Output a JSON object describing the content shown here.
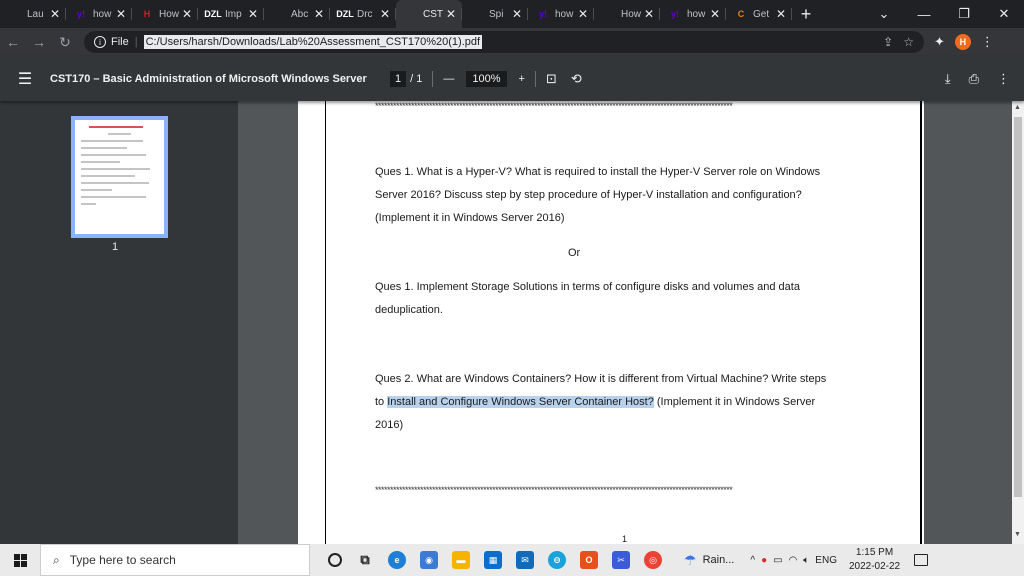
{
  "browser": {
    "tabs": [
      {
        "title": "Lau",
        "icon": "chrome-icon",
        "fav_text": "",
        "color": "#e8eaed",
        "active": false
      },
      {
        "title": "how",
        "icon": "yahoo-icon",
        "fav_text": "y!",
        "color": "#6001d2",
        "active": false
      },
      {
        "title": "How",
        "icon": "h-logo-icon",
        "fav_text": "H",
        "color": "#d11f2a",
        "active": false
      },
      {
        "title": "Imp",
        "icon": "dzl-icon",
        "fav_text": "DZL",
        "color": "#ffffff",
        "active": false
      },
      {
        "title": "Abc",
        "icon": "microsoft-icon",
        "fav_text": "",
        "color": "#f25022",
        "active": false
      },
      {
        "title": "Drc",
        "icon": "dzl-icon",
        "fav_text": "DZL",
        "color": "#ffffff",
        "active": false
      },
      {
        "title": "CST",
        "icon": "globe-icon",
        "fav_text": "",
        "color": "#e8eaed",
        "active": true
      },
      {
        "title": "Spi",
        "icon": "spiceworks-icon",
        "fav_text": "",
        "color": "#3dba4e",
        "active": false
      },
      {
        "title": "how",
        "icon": "yahoo-icon",
        "fav_text": "y!",
        "color": "#6001d2",
        "active": false
      },
      {
        "title": "How",
        "icon": "pencil-icon",
        "fav_text": "",
        "color": "#4a90d9",
        "active": false
      },
      {
        "title": "how",
        "icon": "yahoo-icon",
        "fav_text": "y!",
        "color": "#6001d2",
        "active": false
      },
      {
        "title": "Get",
        "icon": "c-logo-icon",
        "fav_text": "C",
        "color": "#f57c00",
        "active": false
      }
    ],
    "new_tab_label": "+",
    "address": {
      "scheme_label": "File",
      "url": "C:/Users/harsh/Downloads/Lab%20Assessment_CST170%20(1).pdf"
    },
    "avatar_letter": "H"
  },
  "pdf": {
    "title": "CST170 – Basic Administration of Microsoft Windows Server",
    "page_current": "1",
    "page_total": "/ 1",
    "zoom": "100%",
    "thumbnail_page_number": "1",
    "stars": "***********************************************************************************************************************",
    "questions": {
      "q1_line1": "Ques 1.  What is a Hyper-V? What is required to install the Hyper-V Server role on Windows",
      "q1_line2": "Server 2016? Discuss step by step procedure of Hyper-V installation and configuration?",
      "q1_line3": "(Implement it in Windows Server 2016)",
      "or": "Or",
      "q1b_line1": "Ques 1. Implement Storage Solutions in terms of configure disks and volumes and data",
      "q1b_line2": "deduplication.",
      "q2_line1": "Ques 2. What are Windows Containers?  How it is different from Virtual Machine? Write steps",
      "q2_line2_pre": "to",
      "q2_line2_hl": "Install and Configure Windows Server Container Host?",
      "q2_line2_post": " (Implement it in Windows Server",
      "q2_line3": "2016)",
      "page_num_glyph": "1"
    }
  },
  "taskbar": {
    "search_placeholder": "Type here to search",
    "weather": "Rain...",
    "lang": "ENG",
    "time": "1:15 PM",
    "date": "2022-02-22"
  },
  "colors": {
    "highlight": "#b8d2ec",
    "avatar_bg": "#f26b1d",
    "thumb_border": "#8ab4f8"
  }
}
